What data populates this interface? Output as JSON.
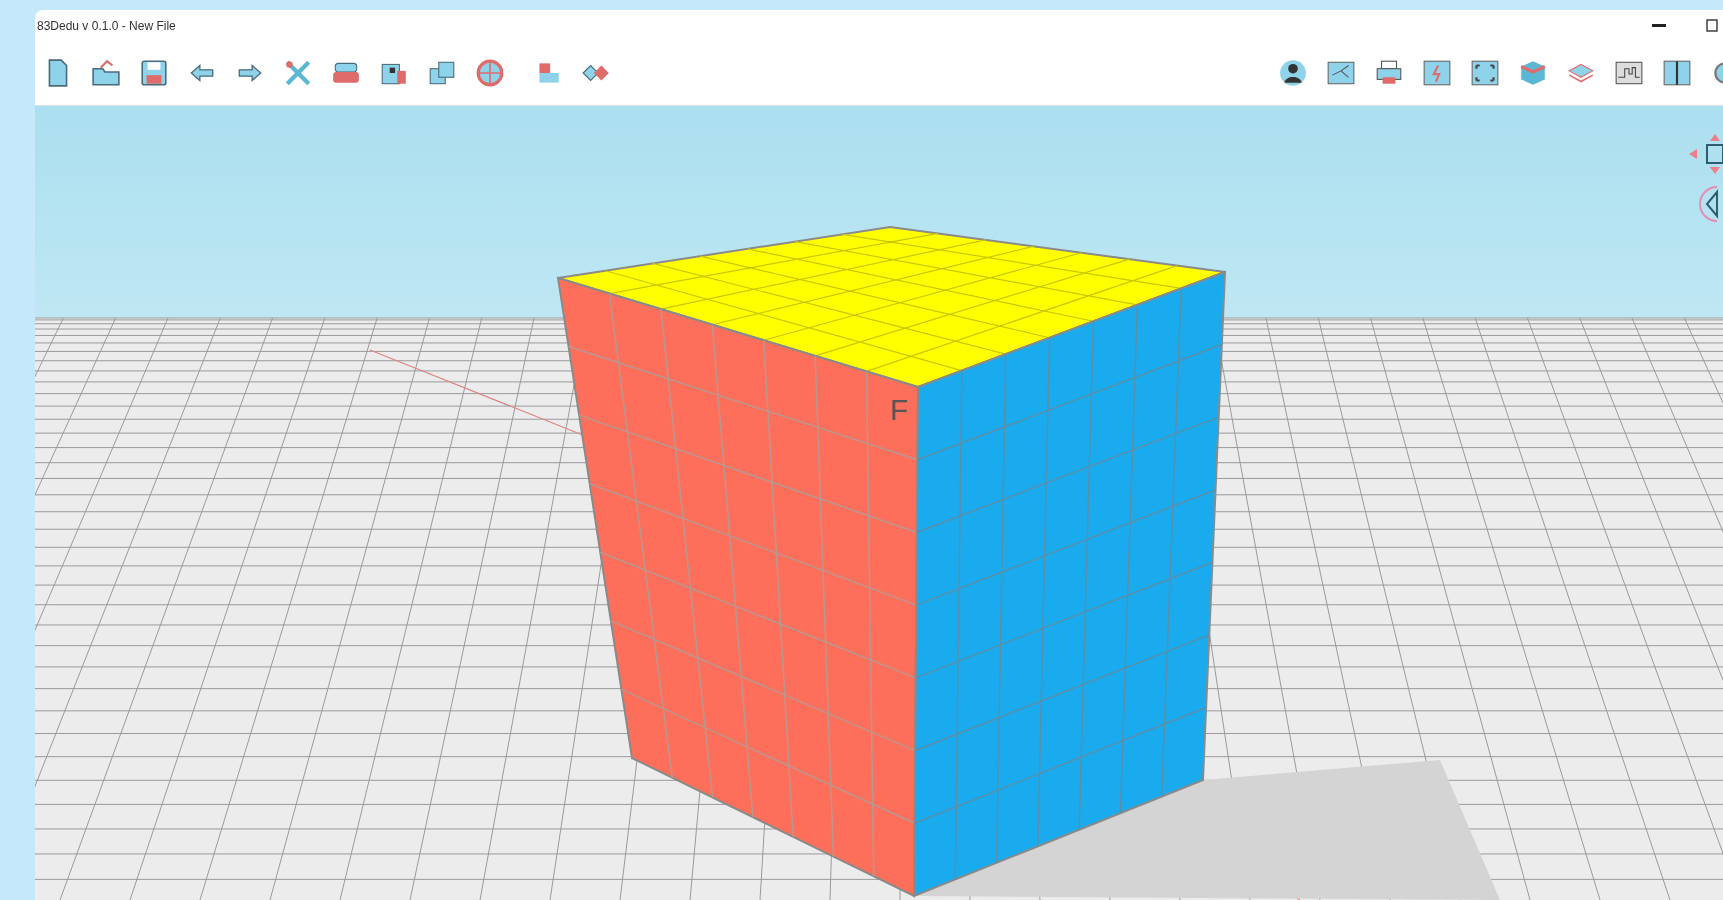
{
  "window": {
    "title": "83Dedu v 0.1.0 - New File"
  },
  "viewport": {
    "cube_label": "F"
  }
}
